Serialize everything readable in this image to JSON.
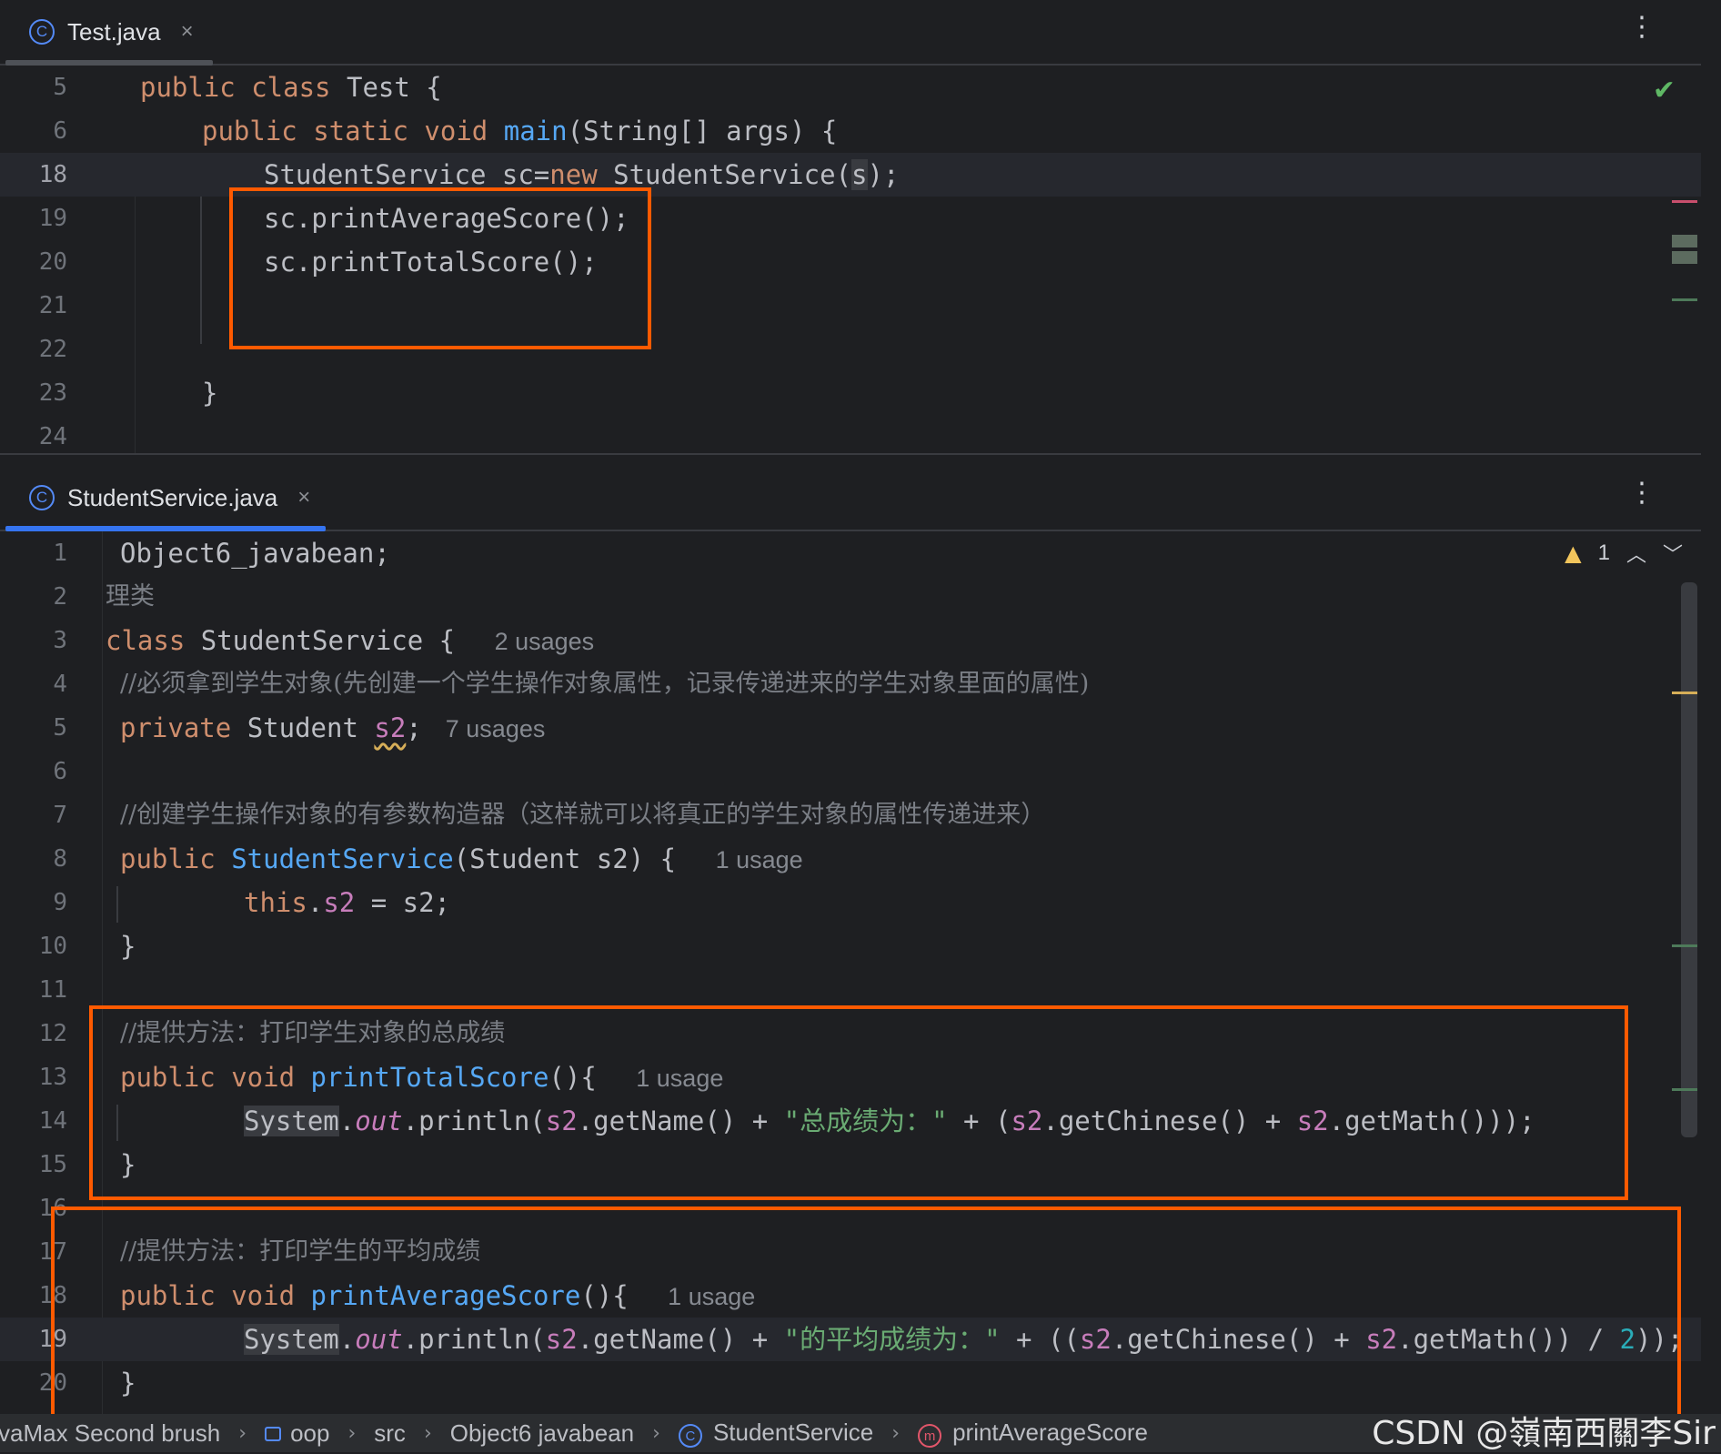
{
  "top_tab": {
    "label": "Test.java",
    "close": "×"
  },
  "bottom_tab": {
    "label": "StudentService.java",
    "close": "×"
  },
  "menu_glyph": "⋮",
  "top_editor": {
    "line_numbers": [
      "5",
      "6",
      "18",
      "19",
      "20",
      "21",
      "22",
      "23",
      "24"
    ],
    "l5": {
      "kw": "public class ",
      "rest": "Test {"
    },
    "l6": {
      "kw": "public static void ",
      "fn": "main",
      "rest": "(String[] args) {"
    },
    "l18": {
      "a": "StudentService sc=",
      "kw": "new",
      "b": " StudentService(",
      "c": "s",
      "d": ");"
    },
    "l19": "sc.printAverageScore();",
    "l20": "sc.printTotalScore();",
    "l23": "}"
  },
  "bottom_editor": {
    "line_numbers": [
      "1",
      "2",
      "3",
      "4",
      "5",
      "6",
      "7",
      "8",
      "9",
      "10",
      "11",
      "12",
      "13",
      "14",
      "15",
      "16",
      "17",
      "18",
      "19",
      "20"
    ],
    "l1": "Object6_javabean;",
    "l2": "理类",
    "l3": {
      "kw": "class ",
      "rest": "StudentService { ",
      "hint": "2 usages"
    },
    "l4": "//必须拿到学生对象(先创建一个学生操作对象属性，记录传递进来的学生对象里面的属性)",
    "l5": {
      "kw": "private ",
      "type": "Student ",
      "field": "s2",
      "semi": ";",
      "hint": "7 usages"
    },
    "l7": "//创建学生操作对象的有参数构造器（这样就可以将真正的学生对象的属性传递进来）",
    "l8": {
      "kw": "public ",
      "fn": "StudentService",
      "rest": "(Student s2) { ",
      "hint": "1 usage"
    },
    "l9": {
      "kw": "this",
      "dot": ".",
      "field": "s2",
      "rest": " = s2;"
    },
    "l10": "}",
    "l12": "//提供方法：打印学生对象的总成绩",
    "l13": {
      "kw": "public void ",
      "fn": "printTotalScore",
      "rest": "(){ ",
      "hint": "1 usage"
    },
    "l14": {
      "sys": "System",
      "dot1": ".",
      "out": "out",
      "p1": ".println(",
      "f1": "s2",
      "p2": ".getName() + ",
      "str": "\"总成绩为：\"",
      "p3": " + (",
      "f2": "s2",
      "p4": ".getChinese() + ",
      "f3": "s2",
      "p5": ".getMath()));"
    },
    "l15": "}",
    "l17": "//提供方法：打印学生的平均成绩",
    "l18": {
      "kw": "public void ",
      "fn": "printAverageScore",
      "rest": "(){ ",
      "hint": "1 usage"
    },
    "l19": {
      "sys": "System",
      "dot1": ".",
      "out": "out",
      "p1": ".println(",
      "f1": "s2",
      "p2": ".getName() + ",
      "str": "\"的平均成绩为：\"",
      "p3": " + ((",
      "f2": "s2",
      "p4": ".getChinese() + ",
      "f3": "s2",
      "p5": ".getMath()) / ",
      "num": "2",
      "p6": "));"
    },
    "l20": "}",
    "warning_count": "1",
    "warning_icon": "warning-triangle-icon"
  },
  "breadcrumb": {
    "items": [
      "vaMax Second brush",
      "oop",
      "src",
      "Object6 javabean",
      "StudentService",
      "printAverageScore"
    ],
    "separator": "›"
  },
  "watermark": "CSDN @嶺南西關李Sir",
  "colors": {
    "background": "#1e1f22",
    "keyword": "#cf8e6d",
    "function": "#56a8f5",
    "field": "#c77dbb",
    "string": "#6aab73",
    "number": "#2aacb8",
    "comment": "#7a7e85",
    "annotation_box": "#ff5a00",
    "tab_accent": "#3574f0"
  }
}
